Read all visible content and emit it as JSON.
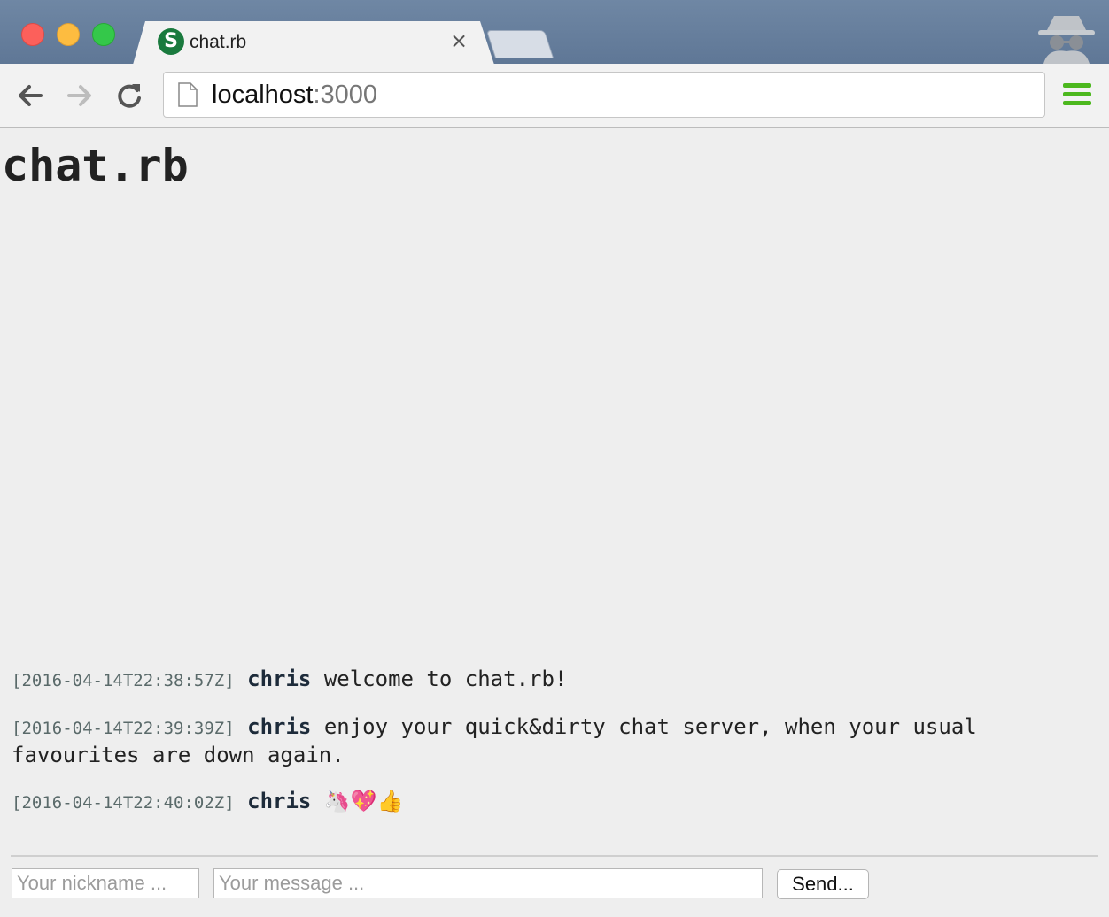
{
  "browser": {
    "tab": {
      "title": "chat.rb",
      "favicon": "S",
      "close": "×"
    },
    "url": {
      "host": "localhost",
      "port": ":3000"
    }
  },
  "page": {
    "title": "chat.rb",
    "messages": [
      {
        "timestamp": "[2016-04-14T22:38:57Z]",
        "nick": "chris",
        "text": "welcome to chat.rb!"
      },
      {
        "timestamp": "[2016-04-14T22:39:39Z]",
        "nick": "chris",
        "text": "enjoy your quick&dirty chat server, when your usual favourites are down again."
      },
      {
        "timestamp": "[2016-04-14T22:40:02Z]",
        "nick": "chris",
        "text": "🦄💖👍"
      }
    ],
    "form": {
      "nickname_placeholder": "Your nickname ...",
      "message_placeholder": "Your message ...",
      "send_label": "Send..."
    }
  },
  "colors": {
    "accent_menu": "#4cb81e",
    "favicon": "#1a7a3e",
    "titlebar": "#6f87a4"
  }
}
